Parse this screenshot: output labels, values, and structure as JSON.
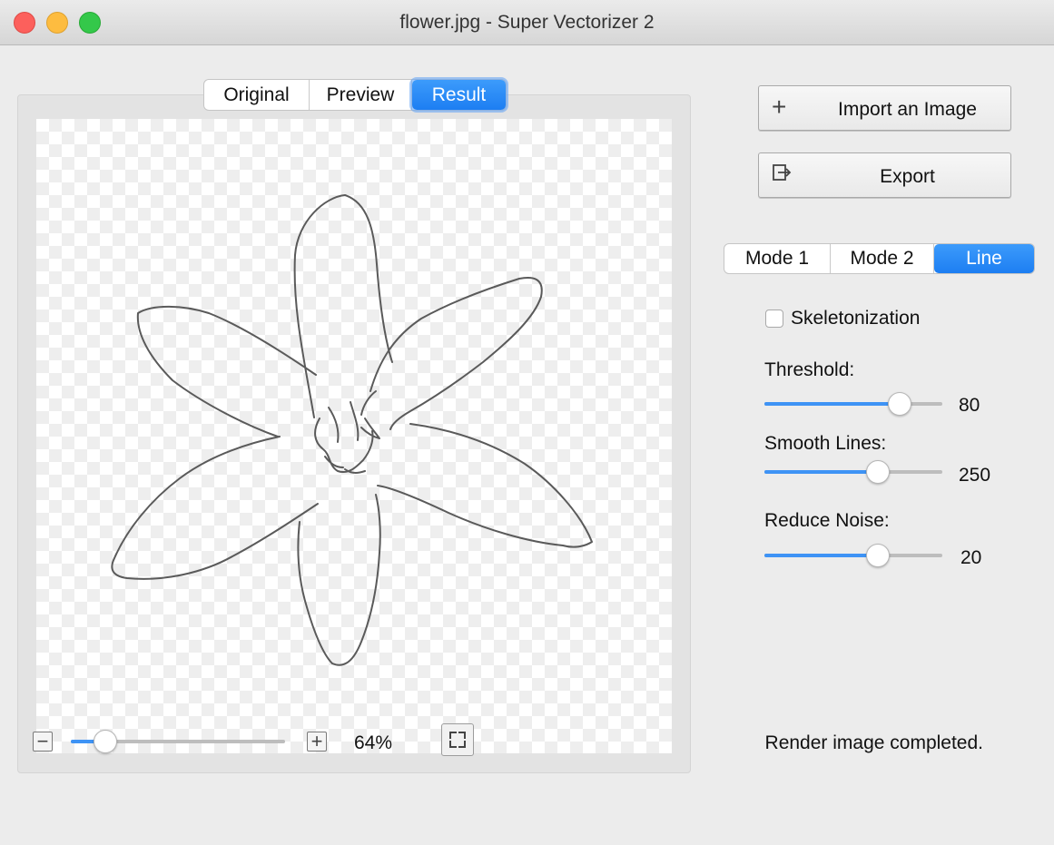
{
  "window": {
    "title": "flower.jpg - Super Vectorizer 2"
  },
  "view_tabs": [
    {
      "label": "Original",
      "active": false
    },
    {
      "label": "Preview",
      "active": false
    },
    {
      "label": "Result",
      "active": true
    }
  ],
  "actions": {
    "import_label": "Import an Image",
    "import_icon": "plus-icon",
    "export_label": "Export",
    "export_icon": "export-icon"
  },
  "mode_tabs": [
    {
      "label": "Mode 1",
      "active": false
    },
    {
      "label": "Mode 2",
      "active": false
    },
    {
      "label": "Line",
      "active": true
    }
  ],
  "settings": {
    "skeletonization": {
      "label": "Skeletonization",
      "checked": false
    },
    "threshold": {
      "label": "Threshold:",
      "value": "80",
      "fraction": 0.76
    },
    "smooth_lines": {
      "label": "Smooth Lines:",
      "value": "250",
      "fraction": 0.64
    },
    "reduce_noise": {
      "label": "Reduce Noise:",
      "value": "20",
      "fraction": 0.64
    }
  },
  "zoom": {
    "value": "64%",
    "fraction": 0.16,
    "minus_icon": "minus-icon",
    "plus_icon": "plus-icon",
    "fit_icon": "fit-screen-icon"
  },
  "status": {
    "text": "Render image completed."
  },
  "colors": {
    "accent": "#1d7ef2",
    "close": "#fc605c",
    "minimize": "#fdbc40",
    "maximize": "#34c84a"
  }
}
